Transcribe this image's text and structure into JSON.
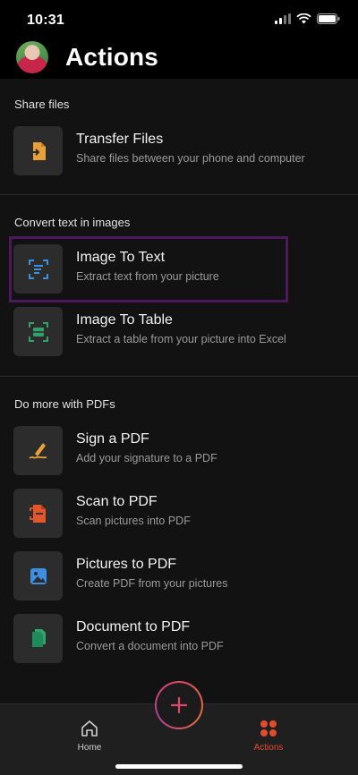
{
  "status_bar": {
    "time": "10:31"
  },
  "header": {
    "title": "Actions"
  },
  "sections": [
    {
      "title": "Share files",
      "items": [
        {
          "title": "Transfer Files",
          "subtitle": "Share files between your phone and computer",
          "icon": "transfer-icon"
        }
      ]
    },
    {
      "title": "Convert text in images",
      "items": [
        {
          "title": "Image To Text",
          "subtitle": "Extract text from your picture",
          "icon": "image-to-text-icon"
        },
        {
          "title": "Image To Table",
          "subtitle": "Extract a table from your picture into Excel",
          "icon": "image-to-table-icon"
        }
      ]
    },
    {
      "title": "Do more with PDFs",
      "items": [
        {
          "title": "Sign a PDF",
          "subtitle": "Add your signature to a PDF",
          "icon": "signature-icon"
        },
        {
          "title": "Scan to PDF",
          "subtitle": "Scan pictures into PDF",
          "icon": "scan-icon"
        },
        {
          "title": "Pictures to PDF",
          "subtitle": "Create PDF from your pictures",
          "icon": "pictures-icon"
        },
        {
          "title": "Document to PDF",
          "subtitle": "Convert a document into PDF",
          "icon": "document-icon"
        }
      ]
    }
  ],
  "bottom_nav": {
    "home_label": "Home",
    "actions_label": "Actions",
    "active_tab": "Actions"
  },
  "colors": {
    "accent_active": "#e14b2e",
    "highlight_border": "#4b1a5c",
    "icon_orange": "#e8a13a",
    "icon_blue": "#3d8fe0",
    "icon_green": "#2fa36b",
    "icon_red": "#e2552d"
  }
}
